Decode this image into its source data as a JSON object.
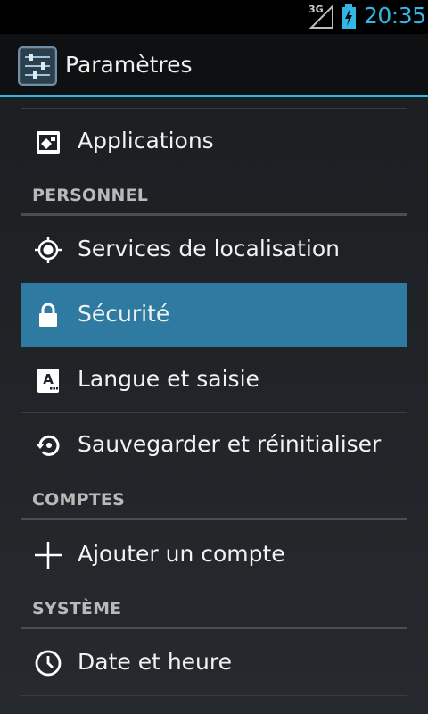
{
  "status_bar": {
    "network": "3G",
    "time": "20:35",
    "icons": [
      "signal-icon",
      "battery-charging-icon"
    ]
  },
  "action_bar": {
    "title": "Paramètres",
    "icon": "settings-sliders-icon"
  },
  "items": {
    "applications": {
      "label": "Applications",
      "icon": "applications-icon"
    },
    "location": {
      "label": "Services de localisation",
      "icon": "location-icon"
    },
    "security": {
      "label": "Sécurité",
      "icon": "lock-icon",
      "selected": true
    },
    "language": {
      "label": "Langue et saisie",
      "icon": "keyboard-a-icon"
    },
    "backup": {
      "label": "Sauvegarder et réinitialiser",
      "icon": "backup-restore-icon"
    },
    "add_account": {
      "label": "Ajouter un compte",
      "icon": "plus-icon"
    },
    "date_time": {
      "label": "Date et heure",
      "icon": "clock-icon"
    }
  },
  "sections": {
    "personal": "PERSONNEL",
    "accounts": "COMPTES",
    "system": "SYSTÈME"
  },
  "colors": {
    "accent": "#33b5e5",
    "selected_row": "#2e7aa0",
    "background": "#1b1e21"
  }
}
